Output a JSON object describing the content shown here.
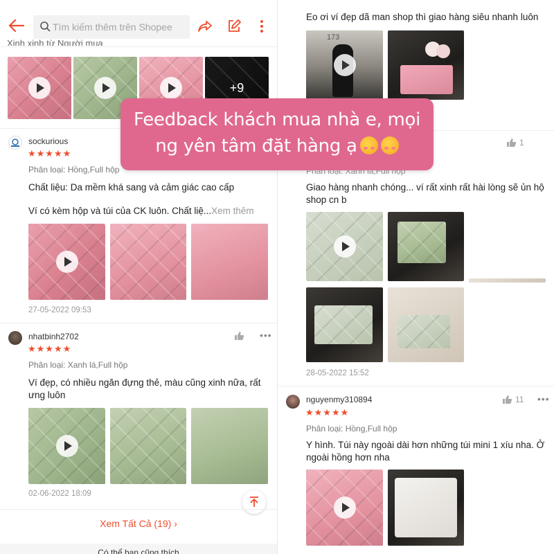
{
  "search": {
    "placeholder": "Tìm kiếm thêm trên Shopee"
  },
  "top_cut_text": "Xinh xinh từ Người mua",
  "more_media_count": "+9",
  "banner": {
    "line1": "Feedback khách mua nhà e, mọi",
    "line2": "ng yên tâm đặt hàng ạ"
  },
  "reviews_left": [
    {
      "username": "sockurious",
      "stars": "★★★★★",
      "variant": "Phân loại: Hồng,Full hộp",
      "text1": "Chất liệu: Da mềm khá sang và cảm giác cao cấp",
      "text2": "Ví có kèm hộp và túi của CK luôn. Chất liệ...",
      "see_more": "Xem thêm",
      "date": "27-05-2022 09:53"
    },
    {
      "username": "nhatbinh2702",
      "stars": "★★★★★",
      "variant": "Phân loại: Xanh lá,Full hộp",
      "text1": "Ví đẹp, có nhiều ngăn đựng thẻ, màu cũng xinh nữa, rất ưng luôn",
      "date": "02-06-2022 18:09"
    }
  ],
  "view_all": "Xem Tất Cả (19) ›",
  "footer_cut": "Có thể bạn cũng thích",
  "reviews_right": [
    {
      "text1": "Eo ơi ví đẹp dã man shop thì giao hàng siêu nhanh luôn"
    },
    {
      "like_count": "1",
      "variant": "Phân loại: Xanh lá,Full hộp",
      "text1": "Giao hàng nhanh chóng... ví rất xinh rất hài lòng sẽ ủn hộ shop cn b",
      "date": "28-05-2022 15:52"
    },
    {
      "username": "nguyenmy310894",
      "like_count": "11",
      "stars": "★★★★★",
      "variant": "Phân loại: Hồng,Full hộp",
      "text1": "Y hình. Túi này ngoài dài hơn những túi mini 1 xíu nha. Ở ngoài hồng hơn nha"
    }
  ],
  "photo_label_173": "173",
  "colors": {
    "accent": "#ee4d2d",
    "banner": "#e0688e"
  }
}
